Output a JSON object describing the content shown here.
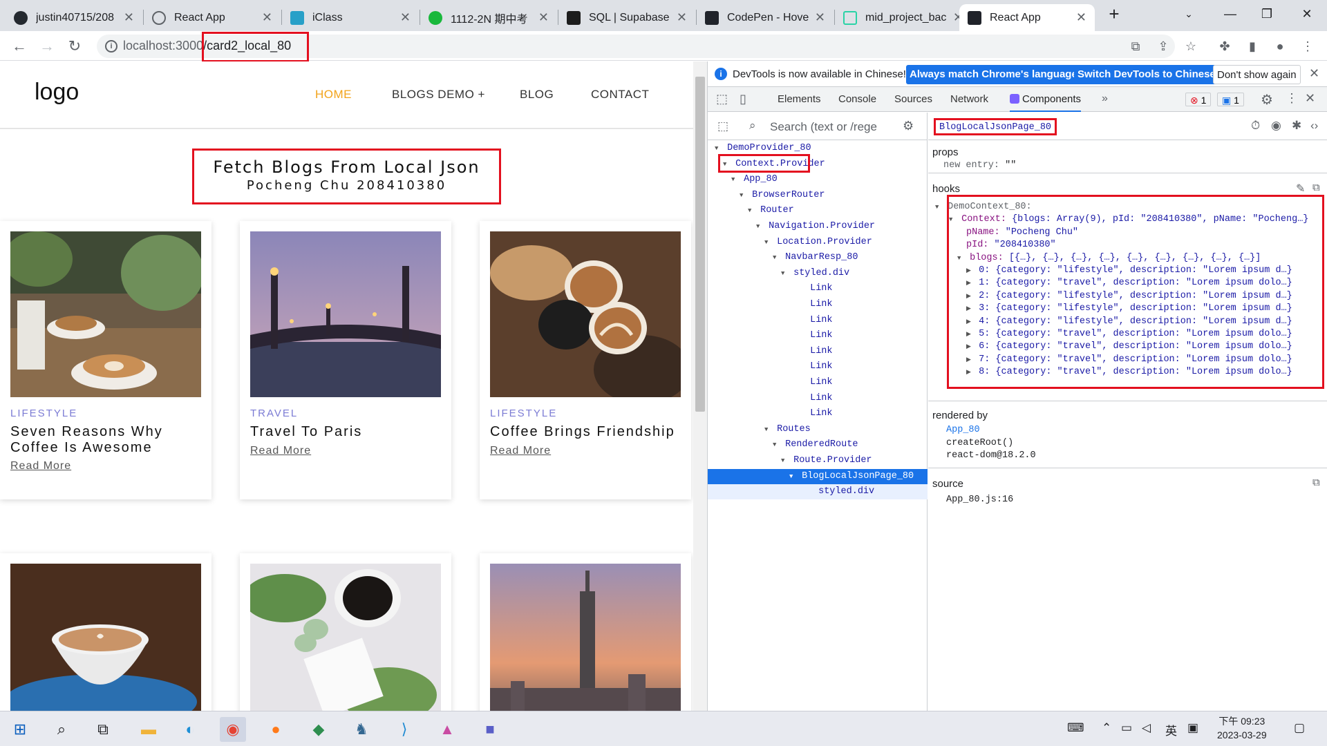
{
  "browser": {
    "tabs": [
      {
        "title": "justin40715/208",
        "icon": "github-icon"
      },
      {
        "title": "React App",
        "icon": "globe-icon"
      },
      {
        "title": "iClass",
        "icon": "iclass-icon"
      },
      {
        "title": "1112-2N 期中考",
        "icon": "evernote-icon"
      },
      {
        "title": "SQL | Supabase",
        "icon": "supabase-icon"
      },
      {
        "title": "CodePen - Hove",
        "icon": "react-icon"
      },
      {
        "title": "mid_project_bac",
        "icon": "codesandbox-icon"
      },
      {
        "title": "React App",
        "icon": "react-icon",
        "active": true
      }
    ],
    "url_host": "localhost:3000",
    "url_path": "/card2_local_80"
  },
  "page": {
    "logo": "logo",
    "nav": [
      "HOME",
      "BLOGS DEMO +",
      "BLOG",
      "CONTACT"
    ],
    "heading": "Fetch Blogs From Local Json",
    "subheading": "Pocheng Chu 208410380",
    "read_more": "Read More",
    "cards": [
      {
        "category": "LIFESTYLE",
        "title": "Seven Reasons Why Coffee Is Awesome"
      },
      {
        "category": "TRAVEL",
        "title": "Travel To Paris"
      },
      {
        "category": "LIFESTYLE",
        "title": "Coffee Brings Friendship"
      }
    ]
  },
  "devtools": {
    "info": {
      "text": "DevTools is now available in Chinese!",
      "btn_match": "Always match Chrome's language",
      "btn_switch": "Switch DevTools to Chinese",
      "btn_dismiss": "Don't show again"
    },
    "tabs": [
      "Elements",
      "Console",
      "Sources",
      "Network",
      "Components"
    ],
    "active_tab": "Components",
    "errors": "1",
    "messages": "1",
    "search_placeholder": "Search (text or /rege",
    "tree": [
      {
        "label": "DemoProvider_80",
        "indent": 1,
        "tri": "▼"
      },
      {
        "label": "Context.Provider",
        "indent": 2,
        "tri": "▼",
        "boxed": true
      },
      {
        "label": "App_80",
        "indent": 3,
        "tri": "▼"
      },
      {
        "label": "BrowserRouter",
        "indent": 4,
        "tri": "▼"
      },
      {
        "label": "Router",
        "indent": 5,
        "tri": "▼"
      },
      {
        "label": "Navigation.Provider",
        "indent": 6,
        "tri": "▼"
      },
      {
        "label": "Location.Provider",
        "indent": 7,
        "tri": "▼"
      },
      {
        "label": "NavbarResp_80",
        "indent": 8,
        "tri": "▼"
      },
      {
        "label": "styled.div",
        "indent": 9,
        "tri": "▼"
      },
      {
        "label": "Link",
        "indent": 11,
        "tri": ""
      },
      {
        "label": "Link",
        "indent": 11,
        "tri": ""
      },
      {
        "label": "Link",
        "indent": 11,
        "tri": ""
      },
      {
        "label": "Link",
        "indent": 11,
        "tri": ""
      },
      {
        "label": "Link",
        "indent": 11,
        "tri": ""
      },
      {
        "label": "Link",
        "indent": 11,
        "tri": ""
      },
      {
        "label": "Link",
        "indent": 11,
        "tri": ""
      },
      {
        "label": "Link",
        "indent": 11,
        "tri": ""
      },
      {
        "label": "Link",
        "indent": 11,
        "tri": ""
      },
      {
        "label": "Routes",
        "indent": 7,
        "tri": "▼"
      },
      {
        "label": "RenderedRoute",
        "indent": 8,
        "tri": "▼"
      },
      {
        "label": "Route.Provider",
        "indent": 9,
        "tri": "▼"
      },
      {
        "label": "BlogLocalJsonPage_80",
        "indent": 10,
        "tri": "▼",
        "selected": true
      },
      {
        "label": "styled.div",
        "indent": 12,
        "tri": "",
        "sub": true
      }
    ],
    "selected_component": "BlogLocalJsonPage_80",
    "props_title": "props",
    "props_key": "new entry:",
    "props_val": "\"\"",
    "hooks_title": "hooks",
    "hook_name": "DemoContext_80:",
    "context_line": "{blogs: Array(9), pId: \"208410380\", pName: \"Pocheng…}",
    "pName": "\"Pocheng Chu\"",
    "pId": "\"208410380\"",
    "blogs_summary": "[{…}, {…}, {…}, {…}, {…}, {…}, {…}, {…}, {…}]",
    "blogs": [
      "0: {category: \"lifestyle\", description: \"Lorem ipsum d…}",
      "1: {category: \"travel\", description: \"Lorem ipsum dolo…}",
      "2: {category: \"lifestyle\", description: \"Lorem ipsum d…}",
      "3: {category: \"lifestyle\", description: \"Lorem ipsum d…}",
      "4: {category: \"lifestyle\", description: \"Lorem ipsum d…}",
      "5: {category: \"travel\", description: \"Lorem ipsum dolo…}",
      "6: {category: \"travel\", description: \"Lorem ipsum dolo…}",
      "7: {category: \"travel\", description: \"Lorem ipsum dolo…}",
      "8: {category: \"travel\", description: \"Lorem ipsum dolo…}"
    ],
    "rendered_by_title": "rendered by",
    "rendered_by": [
      "App_80",
      "createRoot()",
      "react-dom@18.2.0"
    ],
    "source_title": "source",
    "source": "App_80.js:16"
  },
  "taskbar": {
    "lang": "英",
    "time": "下午 09:23",
    "date": "2023-03-29"
  },
  "colors": {
    "accent": "#f2a31a",
    "category": "#7b7bd4",
    "highlight_box": "#e3101f",
    "devtools_blue": "#1a73e8"
  }
}
